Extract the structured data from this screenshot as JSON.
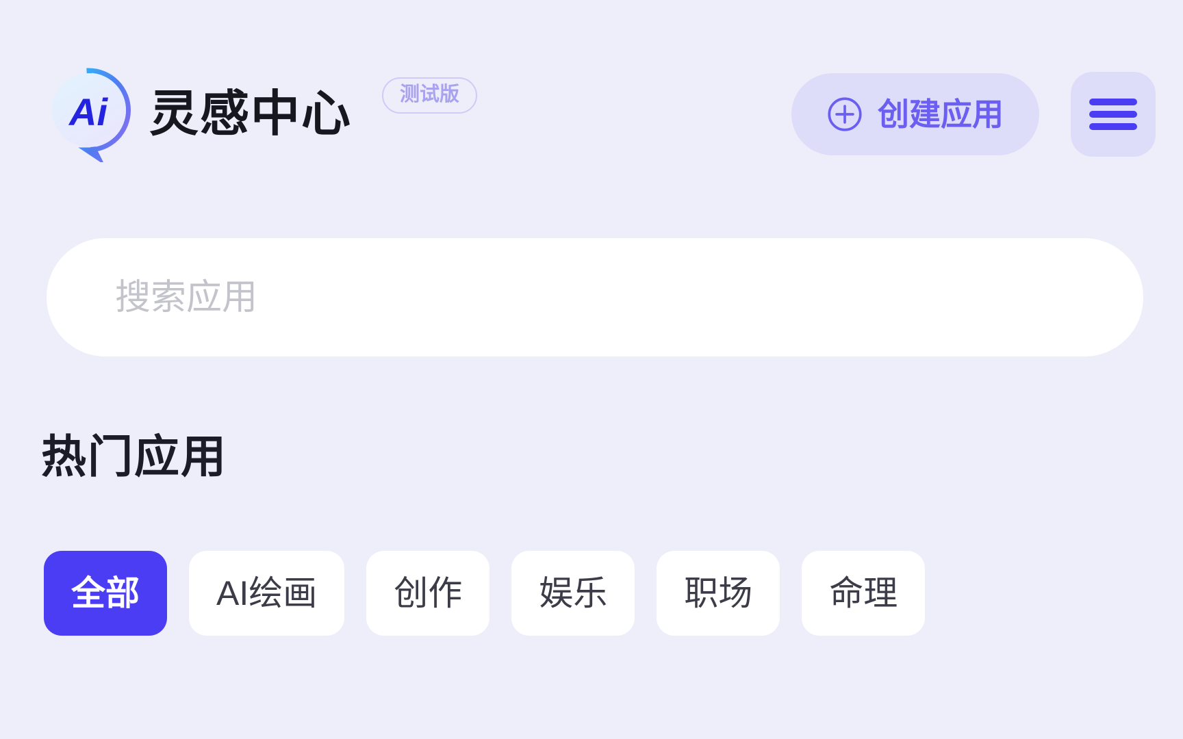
{
  "app": {
    "title": "灵感中心",
    "badge": "测试版",
    "logo_text": "Ai"
  },
  "header": {
    "create_button": {
      "label": "创建应用",
      "icon": "plus-circle-icon"
    },
    "menu_button": {
      "icon": "hamburger-menu-icon"
    }
  },
  "search": {
    "placeholder": "搜索应用",
    "value": ""
  },
  "main": {
    "section_title": "热门应用",
    "tabs": [
      {
        "label": "全部",
        "active": true
      },
      {
        "label": "AI绘画",
        "active": false
      },
      {
        "label": "创作",
        "active": false
      },
      {
        "label": "娱乐",
        "active": false
      },
      {
        "label": "职场",
        "active": false
      },
      {
        "label": "命理",
        "active": false
      }
    ]
  },
  "colors": {
    "background": "#eeeefb",
    "accent": "#4b3df3",
    "accent_soft": "#ddddf9",
    "accent_text": "#6b5ef0",
    "badge_border": "#cfcaf6",
    "badge_text": "#a9a2ef",
    "card": "#ffffff",
    "placeholder": "#c3c3cc",
    "heading": "#1c1c28"
  }
}
